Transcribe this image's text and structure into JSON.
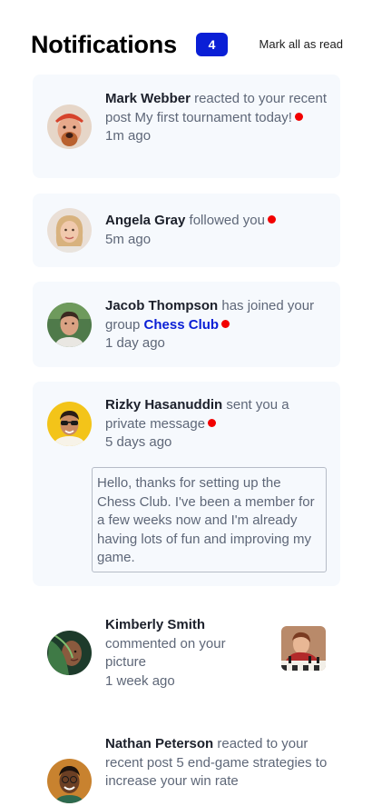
{
  "header": {
    "title": "Notifications",
    "unread_count": "4",
    "mark_all": "Mark all as read"
  },
  "notifications": [
    {
      "name": "Mark Webber",
      "action": "reacted to your recent post",
      "target": "My first tournament today!",
      "time": "1m ago",
      "unread": true,
      "avatar": "avatar-mark-webber"
    },
    {
      "name": "Angela Gray",
      "action": "followed you",
      "time": "5m ago",
      "unread": true,
      "avatar": "avatar-angela-gray"
    },
    {
      "name": "Jacob Thompson",
      "action": "has joined your group",
      "target": "Chess Club",
      "time": "1 day ago",
      "unread": true,
      "avatar": "avatar-jacob-thompson"
    },
    {
      "name": "Rizky Hasanuddin",
      "action": "sent you a private message",
      "time": "5 days ago",
      "unread": true,
      "avatar": "avatar-rizky-hasanuddin",
      "message": "Hello, thanks for setting up the Chess Club. I've been a member for a few weeks now and I'm already having lots of fun and improving my game."
    },
    {
      "name": "Kimberly Smith",
      "action": "commented on your picture",
      "time": "1 week ago",
      "unread": false,
      "avatar": "avatar-kimberly-smith",
      "thumbnail": "chess-picture-thumbnail"
    },
    {
      "name": "Nathan Peterson",
      "action": "reacted to your recent post",
      "target": "5 end-game strategies to increase your win rate",
      "unread": false,
      "avatar": "avatar-nathan-peterson"
    }
  ],
  "colors": {
    "accent": "#0a1fd6",
    "unread_dot": "#f20000",
    "unread_background": "#f6f9fd",
    "heading": "#1c202b",
    "body_text": "#5e6778"
  }
}
